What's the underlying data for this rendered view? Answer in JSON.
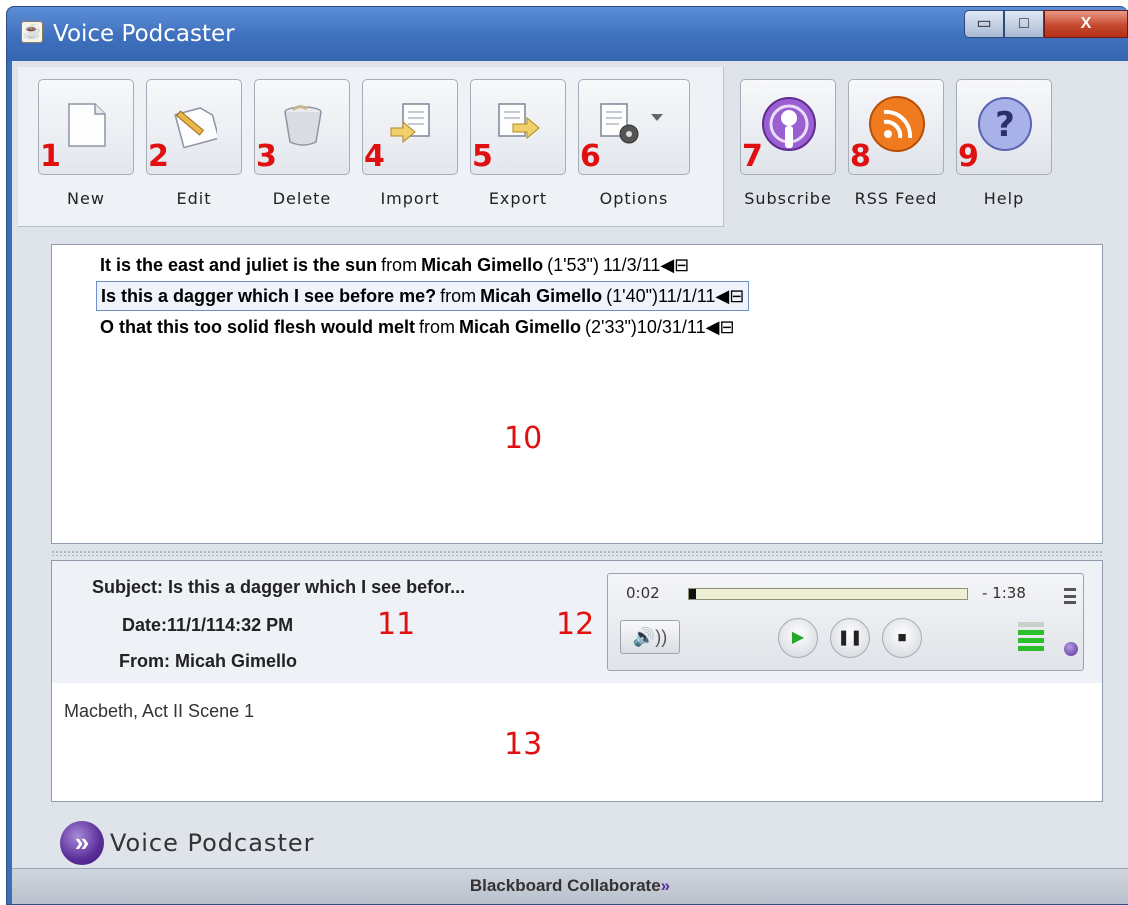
{
  "window": {
    "title": "Voice Podcaster",
    "app_icon": "java-cup-icon",
    "controls": {
      "minimize": "▭",
      "maximize": "□",
      "close": "X"
    }
  },
  "toolbar": {
    "left": [
      {
        "num": "1",
        "label": "New",
        "icon": "new-document-icon"
      },
      {
        "num": "2",
        "label": "Edit",
        "icon": "edit-pencil-icon"
      },
      {
        "num": "3",
        "label": "Delete",
        "icon": "trash-bin-icon"
      },
      {
        "num": "4",
        "label": "Import",
        "icon": "import-icon"
      },
      {
        "num": "5",
        "label": "Export",
        "icon": "export-icon"
      },
      {
        "num": "6",
        "label": "Options",
        "icon": "options-gear-icon"
      }
    ],
    "right": [
      {
        "num": "7",
        "label": "Subscribe",
        "icon": "podcast-icon"
      },
      {
        "num": "8",
        "label": "RSS Feed",
        "icon": "rss-icon"
      },
      {
        "num": "9",
        "label": "Help",
        "icon": "help-icon"
      }
    ]
  },
  "messages": [
    {
      "subject": "It is the east and juliet is the sun",
      "from_word": "from",
      "author": "Micah Gimello",
      "duration": "(1'53\")",
      "date": "11/3/11",
      "selected": false
    },
    {
      "subject": "Is this a dagger which I see before me?",
      "from_word": "from",
      "author": "Micah Gimello",
      "duration": "(1'40\")",
      "date": "11/1/11",
      "selected": true
    },
    {
      "subject": "O that this too solid flesh would melt",
      "from_word": "from",
      "author": "Micah Gimello",
      "duration": "(2'33\")",
      "date": "10/31/11",
      "selected": false
    }
  ],
  "message_flag": "◀⊟",
  "annotations": {
    "list": "10",
    "detail": "11",
    "player": "12",
    "body": "13"
  },
  "detail": {
    "subject_label": "Subject:",
    "subject_value": "Is this a dagger which I see befor...",
    "date_label": "Date:",
    "date_value": "11/1/114:32 PM",
    "from_label": "From:",
    "from_value": "Micah Gimello",
    "body": "Macbeth, Act II Scene 1"
  },
  "player": {
    "elapsed": "0:02",
    "remaining": "- 1:38",
    "progress": 0.02,
    "play_symbol": "▶",
    "pause_symbol": "❚❚",
    "stop_symbol": "■",
    "volume_symbol": "🔊))",
    "level_active_color": "#2bc02b",
    "level_idle_color": "#c9d0c9"
  },
  "footer": {
    "brand": "Voice Podcaster",
    "brand_symbol": "»",
    "status": "Blackboard Collaborate",
    "status_symbol": "»"
  }
}
